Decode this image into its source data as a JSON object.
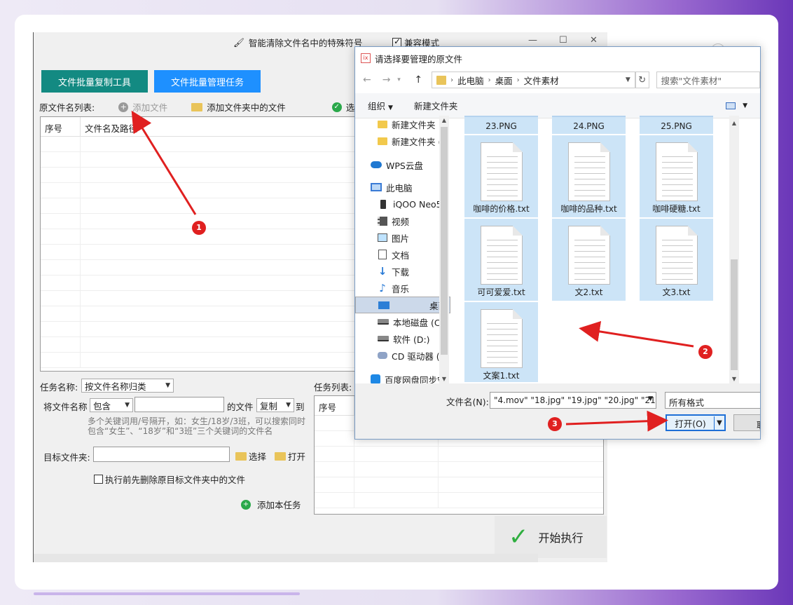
{
  "app": {
    "top_option_label": "智能清除文件名中的特殊符号",
    "compat_label": "兼容模式",
    "compat_checked": true,
    "tab_copy_tool": "文件批量复制工具",
    "tab_manage_task": "文件批量管理任务",
    "source_list_label": "原文件名列表:",
    "add_file": "添加文件",
    "add_folder_files": "添加文件夹中的文件",
    "select_specified": "选中指定",
    "grid_col_index": "序号",
    "grid_col_name": "文件名及路径",
    "task_name_label": "任务名称:",
    "task_name_value": "按文件名称归类",
    "filename_rule_label": "将文件名称",
    "filename_rule_value": "包含",
    "of_file_label": "的文件",
    "action_value": "复制",
    "to_label": "到",
    "hint_text": "多个关键词用/号隔开，如：女生/18岁/3班，可以搜索同时包含“女生”、“18岁”和“3班”三个关键词的文件名",
    "target_folder_label": "目标文件夹:",
    "choose_btn": "选择",
    "open_btn": "打开",
    "delete_before_label": "执行前先删除原目标文件夹中的文件",
    "add_task_btn": "添加本任务",
    "task_list_label": "任务列表:",
    "task_grid_col_index": "序号",
    "start_btn": "开始执行"
  },
  "dialog": {
    "title": "请选择要管理的原文件",
    "breadcrumb": [
      "此电脑",
      "桌面",
      "文件素材"
    ],
    "search_placeholder": "搜索\"文件素材\"",
    "toolbar_organize": "组织",
    "toolbar_new_folder": "新建文件夹",
    "sidebar": [
      {
        "label": "新建文件夹",
        "icon": "folder-icon",
        "selected": false
      },
      {
        "label": "新建文件夹 (",
        "icon": "folder-icon",
        "selected": false
      },
      {
        "label": "WPS云盘",
        "icon": "cloud-icon",
        "selected": false
      },
      {
        "label": "此电脑",
        "icon": "computer-icon",
        "selected": false
      },
      {
        "label": "iQOO Neo5",
        "icon": "phone-icon",
        "selected": false
      },
      {
        "label": "视频",
        "icon": "video-icon",
        "selected": false
      },
      {
        "label": "图片",
        "icon": "picture-icon",
        "selected": false
      },
      {
        "label": "文档",
        "icon": "document-icon",
        "selected": false
      },
      {
        "label": "下载",
        "icon": "download-icon",
        "selected": false
      },
      {
        "label": "音乐",
        "icon": "music-icon",
        "selected": false
      },
      {
        "label": "桌面",
        "icon": "desktop-icon",
        "selected": true
      },
      {
        "label": "本地磁盘 (C:",
        "icon": "disk-icon",
        "selected": false
      },
      {
        "label": "软件 (D:)",
        "icon": "disk-icon",
        "selected": false
      },
      {
        "label": "CD 驱动器 (E",
        "icon": "cd-icon",
        "selected": false
      },
      {
        "label": "百度网盘同步空",
        "icon": "baidu-icon",
        "selected": false
      }
    ],
    "files": [
      {
        "name": "23.PNG",
        "partial": true
      },
      {
        "name": "24.PNG",
        "partial": true
      },
      {
        "name": "25.PNG",
        "partial": true
      },
      {
        "name": "咖啡的价格.txt"
      },
      {
        "name": "咖啡的品种.txt"
      },
      {
        "name": "咖啡硬糖.txt"
      },
      {
        "name": "可可爱爱.txt"
      },
      {
        "name": "文2.txt"
      },
      {
        "name": "文3.txt"
      },
      {
        "name": "文案1.txt"
      }
    ],
    "filename_label": "文件名(N):",
    "filename_value": "\"4.mov\" \"18.jpg\" \"19.jpg\" \"20.jpg\" \"21",
    "format_value": "所有格式",
    "open_button": "打开(O)",
    "cancel_button": "取"
  },
  "annotations": {
    "badges": [
      "1",
      "2",
      "3"
    ],
    "arrow_color": "#e02020"
  },
  "colors": {
    "teal": "#138a82",
    "blue": "#1e90ff",
    "selection": "#cce4f7",
    "start_check": "#2eae3f"
  }
}
